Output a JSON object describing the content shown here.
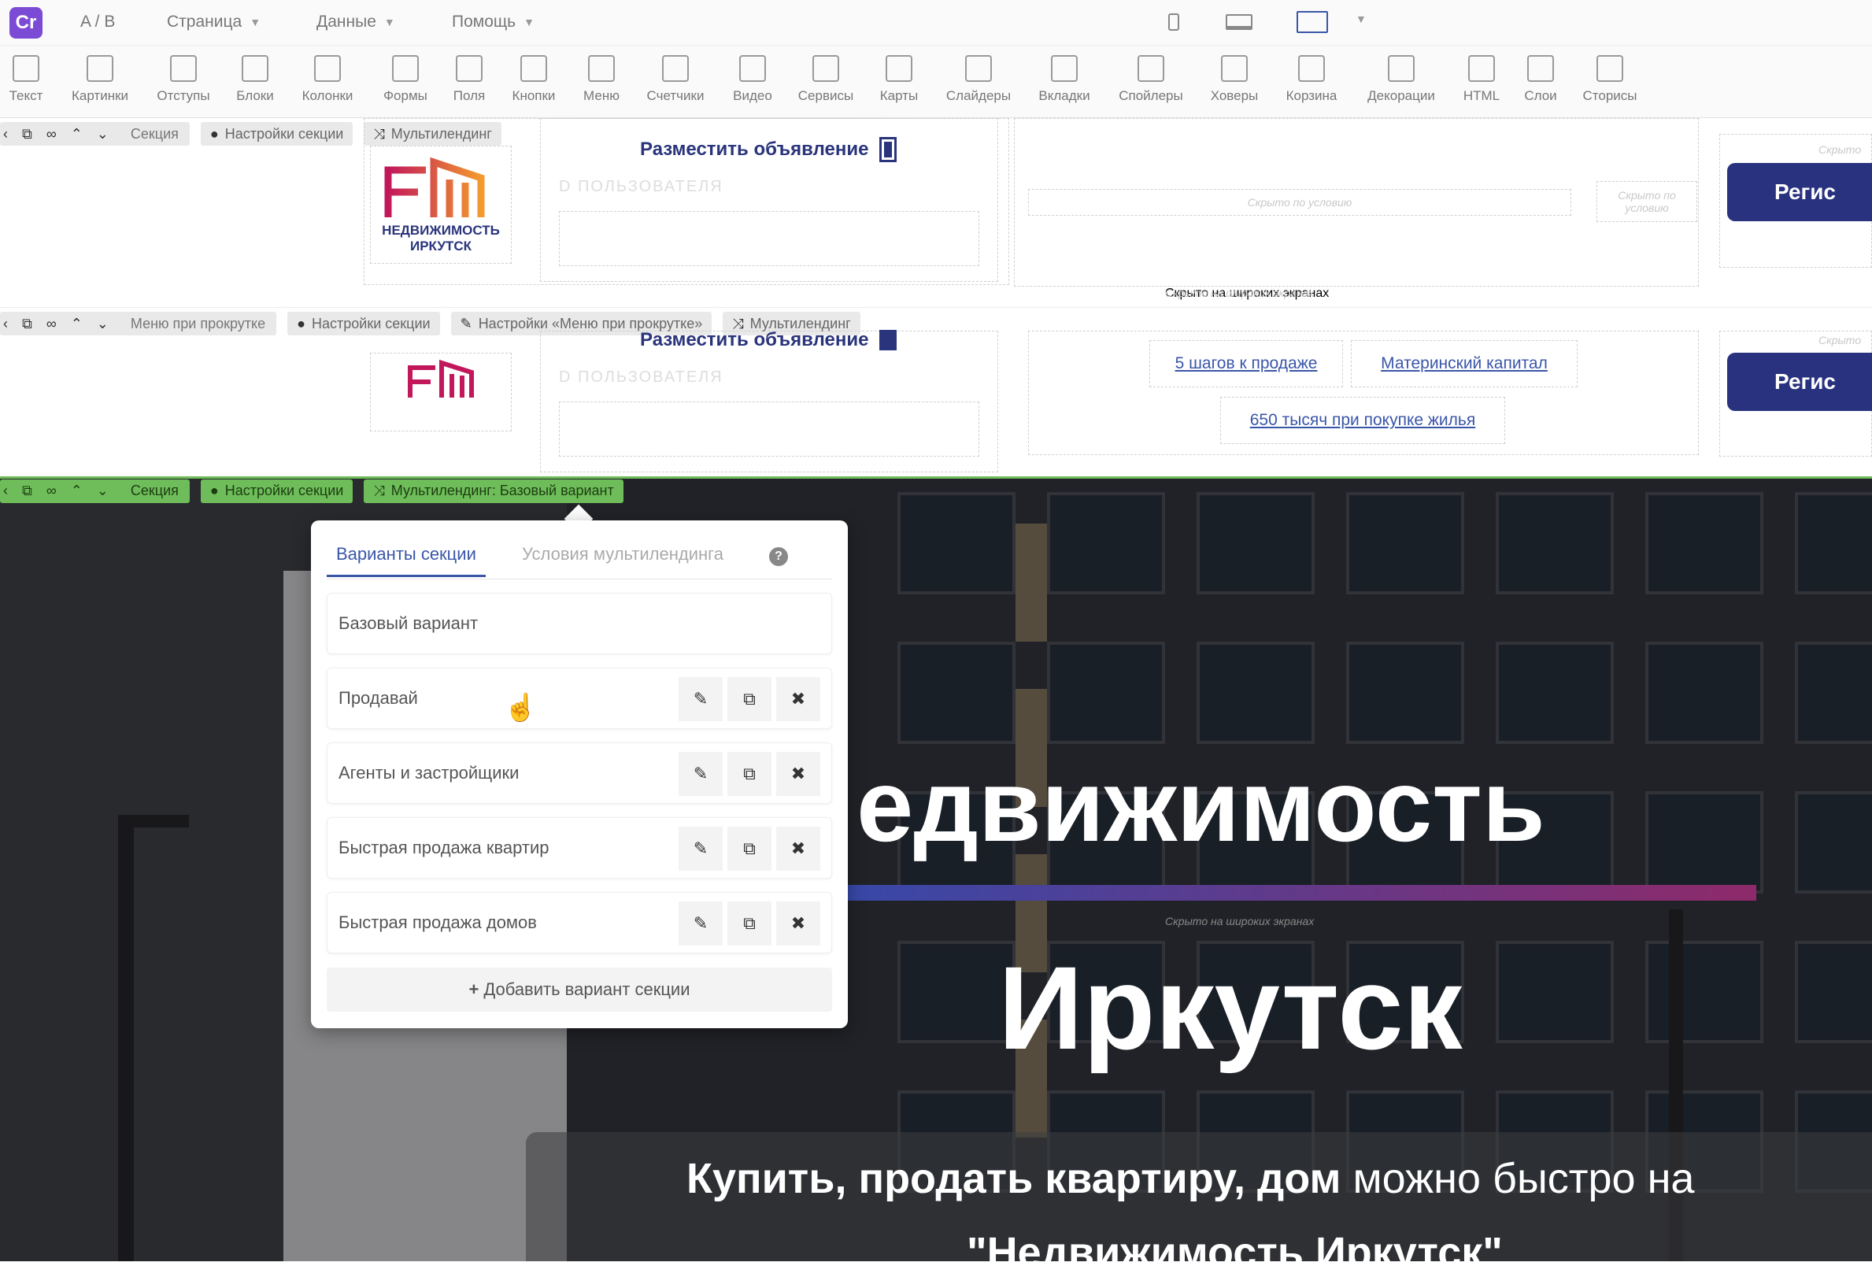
{
  "topbar": {
    "logo": "Cr",
    "ab": "A / B",
    "menus": [
      "Страница",
      "Данные",
      "Помощь"
    ]
  },
  "toolbar": [
    "Текст",
    "Картинки",
    "Отступы",
    "Блоки",
    "Колонки",
    "Формы",
    "Поля",
    "Кнопки",
    "Меню",
    "Счетчики",
    "Видео",
    "Сервисы",
    "Карты",
    "Слайдеры",
    "Вкладки",
    "Спойлеры",
    "Ховеры",
    "Корзина",
    "Декорации",
    "HTML",
    "Слои",
    "Сторисы"
  ],
  "section1": {
    "label": "Секция",
    "settings": "Настройки секции",
    "multi": "Мультилендинг",
    "post_ad": "Разместить объявление",
    "user_field": "D ПОЛЬЗОВАТЕЛЯ",
    "logo_line1": "НЕДВИЖИМОСТЬ",
    "logo_line2": "ИРКУТСК",
    "hidden_cond": "Скрыто по условию",
    "hidden_cond2": "Скрыто по условию",
    "hidden_wide": "Скрыто на широких экранах",
    "hidden_small": "Скрыто",
    "register": "Регис"
  },
  "section2": {
    "label": "Меню при прокрутке",
    "settings": "Настройки секции",
    "menu_settings": "Настройки «Меню при прокрутке»",
    "multi": "Мультилендинг",
    "post_ad": "Разместить объявление",
    "user_field": "D ПОЛЬЗОВАТЕЛЯ",
    "links": [
      "5 шагов к продаже",
      "Материнский капитал",
      "650 тысяч при покупке жилья"
    ],
    "register": "Регис",
    "hidden_small": "Скрыто"
  },
  "section3": {
    "label": "Секция",
    "settings": "Настройки секции",
    "multi": "Мультилендинг: Базовый вариант"
  },
  "popup": {
    "tabs": [
      "Варианты секции",
      "Условия мультилендинга"
    ],
    "help": "?",
    "base": "Базовый вариант",
    "variants": [
      "Продавай",
      "Агенты и застройщики",
      "Быстрая продажа квартир",
      "Быстрая продажа домов"
    ],
    "add": "Добавить вариант секции"
  },
  "hero": {
    "title1": "едвижимость",
    "title2": "Иркутск",
    "hidden_wide": "Скрыто на широких экранах",
    "subtitle_bold": "Купить, продать квартиру, дом",
    "subtitle_rest": " можно быстро на",
    "subtitle2": "\"Недвижимость Иркутск\""
  },
  "colors": {
    "accent": "#3a56a8",
    "register": "#29327f",
    "active_bar": "#6fbd5a",
    "brand": "#7b4bd6"
  }
}
